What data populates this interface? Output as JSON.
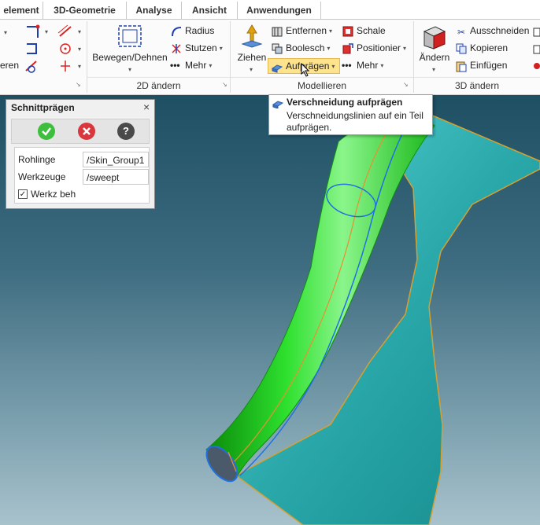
{
  "tabs": [
    "element",
    "3D-Geometrie",
    "Analyse",
    "Ansicht",
    "Anwendungen"
  ],
  "ribbon": {
    "groups": {
      "g2d": "2D ändern",
      "modellieren": "Modellieren",
      "g3d": "3D ändern"
    },
    "left": {
      "eren": "eren"
    },
    "bewegen": "Bewegen/Dehnen",
    "radius": "Radius",
    "stutzen": "Stutzen",
    "mehr1": "Mehr",
    "ziehen": "Ziehen",
    "entfernen": "Entfernen",
    "boolesch": "Boolesch",
    "aufpraegen": "Aufprägen",
    "schale": "Schale",
    "positionier": "Positionier",
    "mehr2": "Mehr",
    "aendern": "Ändern",
    "ausschneiden": "Ausschneiden",
    "kopieren": "Kopieren",
    "einfuegen": "Einfügen"
  },
  "tooltip": {
    "title": "Verschneidung aufprägen",
    "text": "Verschneidungslinien auf ein Teil aufprägen."
  },
  "dialog": {
    "title": "Schnittprägen",
    "close": "×",
    "rohlinge_label": "Rohlinge",
    "rohlinge_value": "/Skin_Group1",
    "werkzeuge_label": "Werkzeuge",
    "werkzeuge_value": "/sweept",
    "werkz_label": "Werkz beh",
    "werkz_checked": "✓"
  },
  "colors": {
    "accent_green": "#3dbf3d",
    "cancel_red": "#d9363e",
    "help_dark": "#4a4a4a",
    "surface_cyan": "#2fb5b5",
    "tube_green": "#22d322"
  }
}
